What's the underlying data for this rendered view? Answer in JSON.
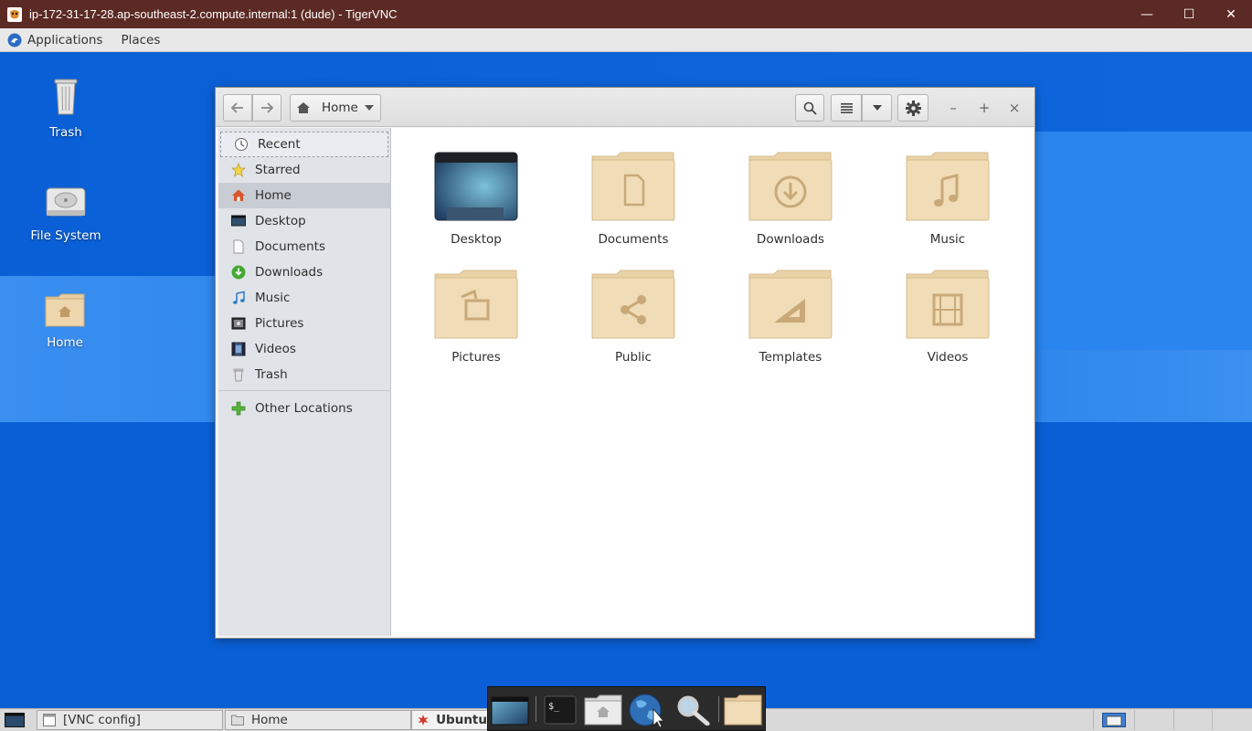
{
  "vnc": {
    "title": "ip-172-31-17-28.ap-southeast-2.compute.internal:1 (dude) - TigerVNC",
    "minimize": "—",
    "maximize": "☐",
    "close": "✕"
  },
  "menubar": {
    "applications": "Applications",
    "places": "Places"
  },
  "desktop_icons": [
    {
      "label": "Trash",
      "icon": "trash-icon"
    },
    {
      "label": "File System",
      "icon": "drive-icon"
    },
    {
      "label": "Home",
      "icon": "home-folder-icon"
    }
  ],
  "file_manager": {
    "location": "Home",
    "minimize": "–",
    "maximize": "+",
    "close": "×",
    "sidebar": [
      {
        "label": "Recent",
        "icon": "recent-icon"
      },
      {
        "label": "Starred",
        "icon": "star-icon"
      },
      {
        "label": "Home",
        "icon": "home-icon"
      },
      {
        "label": "Desktop",
        "icon": "desktop-icon"
      },
      {
        "label": "Documents",
        "icon": "document-icon"
      },
      {
        "label": "Downloads",
        "icon": "download-icon"
      },
      {
        "label": "Music",
        "icon": "music-icon"
      },
      {
        "label": "Pictures",
        "icon": "picture-icon"
      },
      {
        "label": "Videos",
        "icon": "video-icon"
      },
      {
        "label": "Trash",
        "icon": "trash-icon"
      },
      {
        "label": "Other Locations",
        "icon": "plus-icon"
      }
    ],
    "folders": [
      {
        "label": "Desktop",
        "icon": "desktop-folder-icon"
      },
      {
        "label": "Documents",
        "icon": "documents-folder-icon"
      },
      {
        "label": "Downloads",
        "icon": "downloads-folder-icon"
      },
      {
        "label": "Music",
        "icon": "music-folder-icon"
      },
      {
        "label": "Pictures",
        "icon": "pictures-folder-icon"
      },
      {
        "label": "Public",
        "icon": "public-folder-icon"
      },
      {
        "label": "Templates",
        "icon": "templates-folder-icon"
      },
      {
        "label": "Videos",
        "icon": "videos-folder-icon"
      }
    ]
  },
  "taskbar": {
    "tasks": [
      {
        "label": "[VNC config]",
        "icon": "window-icon"
      },
      {
        "label": "Home",
        "icon": "folder-icon"
      },
      {
        "label": "Ubuntu",
        "icon": "ubuntu-icon"
      }
    ]
  },
  "colors": {
    "vnc_title_bg": "#5c2a24",
    "desktop_bg": "#0a5fd6",
    "folder_tan": "#e9cfa3"
  }
}
